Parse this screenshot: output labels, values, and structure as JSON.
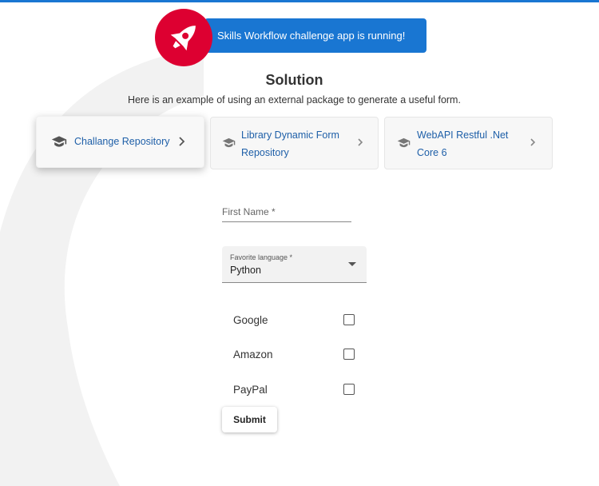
{
  "colors": {
    "brand_blue": "#1976d2",
    "rocket_red": "#dd0031",
    "link_blue": "#1e5fa8",
    "curve_gray": "#f2f2f2"
  },
  "banner": {
    "text": "Skills Workflow challenge app is running!",
    "icon": "rocket-icon"
  },
  "header": {
    "title": "Solution",
    "subtitle": "Here is an example of using an external package to generate a useful form."
  },
  "cards": [
    {
      "lines": [
        "Challange Repository"
      ],
      "icon": "graduation-cap-icon",
      "active": true
    },
    {
      "lines": [
        "Library Dynamic Form",
        "Repository"
      ],
      "icon": "graduation-cap-icon",
      "active": false
    },
    {
      "lines": [
        "WebAPI Restful .Net",
        "Core 6"
      ],
      "icon": "graduation-cap-icon",
      "active": false
    }
  ],
  "form": {
    "first_name_placeholder": "First Name *",
    "language_label": "Favorite language *",
    "language_value": "Python",
    "checkboxes": [
      {
        "label": "Google",
        "checked": false
      },
      {
        "label": "Amazon",
        "checked": false
      },
      {
        "label": "PayPal",
        "checked": false
      }
    ],
    "submit_label": "Submit"
  }
}
